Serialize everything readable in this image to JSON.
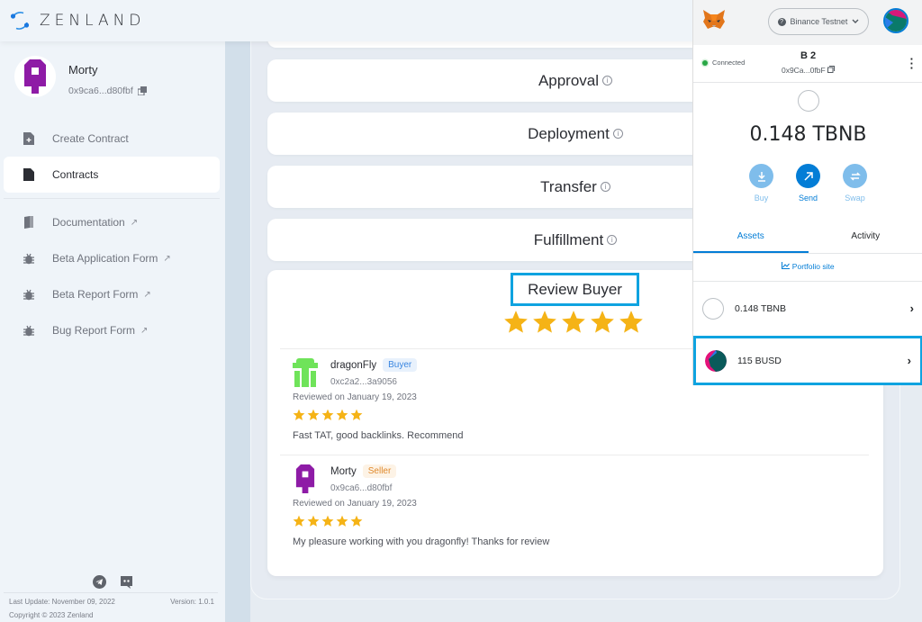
{
  "app": {
    "brand": "ZENLAND"
  },
  "profile": {
    "name": "Morty",
    "address": "0x9ca6...d80fbf"
  },
  "sidebar": {
    "items": [
      {
        "label": "Create Contract",
        "icon": "file-plus-icon",
        "external": false,
        "active": false
      },
      {
        "label": "Contracts",
        "icon": "file-icon",
        "external": false,
        "active": true
      },
      {
        "label": "Documentation",
        "icon": "book-icon",
        "external": true,
        "active": false
      },
      {
        "label": "Beta Application Form",
        "icon": "bug-icon",
        "external": true,
        "active": false
      },
      {
        "label": "Beta Report Form",
        "icon": "bug-icon",
        "external": true,
        "active": false
      },
      {
        "label": "Bug Report Form",
        "icon": "bug-icon",
        "external": true,
        "active": false
      }
    ],
    "external_glyph": "↗",
    "footer": {
      "last_update": "Last Update: November 09, 2022",
      "version": "Version: 1.0.1",
      "copyright": "Copyright © 2023 Zenland",
      "socials": [
        "telegram-icon",
        "discord-icon"
      ]
    }
  },
  "main": {
    "steps": [
      {
        "label": "Approval"
      },
      {
        "label": "Deployment"
      },
      {
        "label": "Transfer"
      },
      {
        "label": "Fulfillment"
      }
    ],
    "review_title": "Review Buyer",
    "review_rating": 5,
    "reviews": [
      {
        "name": "dragonFly",
        "role": "Buyer",
        "address": "0xc2a2...3a9056",
        "date": "Reviewed on January 19, 2023",
        "rating": 5,
        "text": "Fast TAT, good backlinks. Recommend"
      },
      {
        "name": "Morty",
        "role": "Seller",
        "address": "0x9ca6...d80fbf",
        "date": "Reviewed on January 19, 2023",
        "rating": 5,
        "text": "My pleasure working with you dragonfly! Thanks for review"
      }
    ]
  },
  "metamask": {
    "network": "Binance Testnet",
    "network_badge": "?",
    "status": "Connected",
    "account_name": "B 2",
    "account_address": "0x9Ca...0fbF",
    "balance": "0.148 TBNB",
    "actions": [
      {
        "label": "Buy",
        "icon": "download-icon",
        "enabled": false
      },
      {
        "label": "Send",
        "icon": "arrow-up-right-icon",
        "enabled": true
      },
      {
        "label": "Swap",
        "icon": "swap-icon",
        "enabled": false
      }
    ],
    "tabs": [
      {
        "label": "Assets",
        "active": true
      },
      {
        "label": "Activity",
        "active": false
      }
    ],
    "portfolio_link": "Portfolio site",
    "assets": [
      {
        "label": "0.148 TBNB",
        "highlighted": false
      },
      {
        "label": "115 BUSD",
        "highlighted": true
      }
    ]
  },
  "colors": {
    "accent": "#0fa3e0",
    "metamask_blue": "#037dd6",
    "star": "#f5b316",
    "brand_purple": "#8e1ba6",
    "brand_green": "#6fe35a"
  }
}
